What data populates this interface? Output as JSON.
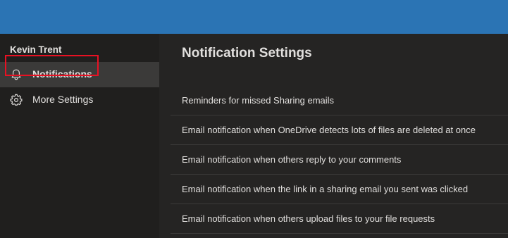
{
  "sidebar": {
    "user_name": "Kevin Trent",
    "items": [
      {
        "label": "Notifications",
        "icon": "bell-icon",
        "selected": true
      },
      {
        "label": "More Settings",
        "icon": "gear-icon",
        "selected": false
      }
    ]
  },
  "main": {
    "title": "Notification Settings",
    "settings": [
      {
        "label": "Reminders for missed Sharing emails"
      },
      {
        "label": "Email notification when OneDrive detects lots of files are deleted at once"
      },
      {
        "label": "Email notification when others reply to your comments"
      },
      {
        "label": "Email notification when the link in a sharing email you sent was clicked"
      },
      {
        "label": "Email notification when others upload files to your file requests"
      }
    ]
  },
  "colors": {
    "header": "#2b74b4",
    "sidebar_bg": "#201f1e",
    "selected_item_bg": "#3b3a39",
    "content_bg": "#252423",
    "text": "#e1dfdd",
    "highlight": "#e81123"
  }
}
